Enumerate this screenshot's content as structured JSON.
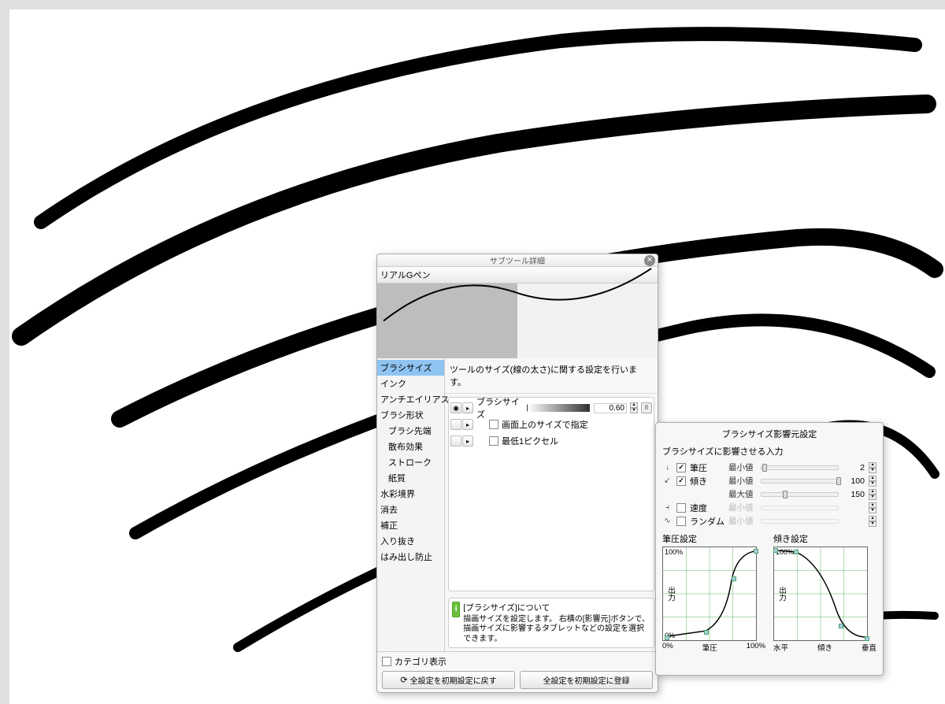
{
  "panel": {
    "title": "サブツール詳細",
    "tool_name": "リアルGペン",
    "desc": "ツールのサイズ(線の太さ)に関する設定を行います。",
    "categories": [
      "ブラシサイズ",
      "インク",
      "アンチエイリアス",
      "ブラシ形状",
      "ブラシ先端",
      "散布効果",
      "ストローク",
      "紙質",
      "水彩境界",
      "消去",
      "補正",
      "入り抜き",
      "はみ出し防止"
    ],
    "selected_category_index": 0,
    "brush_size": {
      "label": "ブラシサイズ",
      "value": "0.60",
      "screen_size_label": "画面上のサイズで指定",
      "min_pixel_label": "最低1ピクセル"
    },
    "help": {
      "title": "[ブラシサイズ]について",
      "body": "描画サイズを設定します。\n右横の[影響元]ボタンで、描画サイズに影響するタブレットなどの設定を選択できます。"
    },
    "footer": {
      "category_show": "カテゴリ表示",
      "reset": "全設定を初期設定に戻す",
      "register": "全設定を初期設定に登録"
    }
  },
  "influence": {
    "title": "ブラシサイズ影響元設定",
    "subtitle": "ブラシサイズに影響させる入力",
    "rows": [
      {
        "icon": "↓",
        "label": "筆圧",
        "checked": true,
        "mm": "最小値",
        "value": "2",
        "thumb": 1
      },
      {
        "icon": "↙",
        "label": "傾き",
        "checked": true,
        "mm": "最小値",
        "value": "100",
        "thumb": 98
      },
      {
        "icon": "",
        "label": "",
        "checked": null,
        "mm": "最大値",
        "value": "150",
        "thumb": 28
      },
      {
        "icon": "⫞",
        "label": "速度",
        "checked": false,
        "mm": "最小値",
        "value": "",
        "thumb": null,
        "disabled": true
      },
      {
        "icon": "∿",
        "label": "ランダム",
        "checked": false,
        "mm": "最小値",
        "value": "",
        "thumb": null,
        "disabled": true
      }
    ],
    "curve1": {
      "title": "筆圧設定",
      "ylabel": "出力",
      "xleft": "0%",
      "xmid": "筆圧",
      "xright": "100%",
      "top": "100%",
      "bot": "0%"
    },
    "curve2": {
      "title": "傾き設定",
      "ylabel": "出力",
      "xleft": "水平",
      "xmid": "傾き",
      "xright": "垂直",
      "top": "100%",
      "bot": ""
    }
  }
}
